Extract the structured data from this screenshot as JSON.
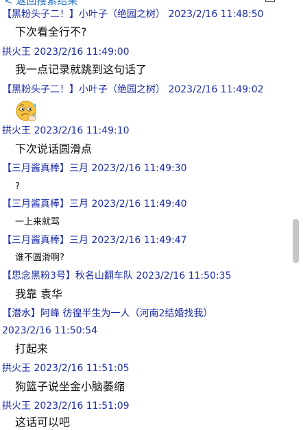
{
  "topbar": {
    "back_label": "< 返回搜索结果",
    "export_icon": "export-icon"
  },
  "messages": [
    {
      "sender": "【黑粉头子二！】小叶子（绝园之树）",
      "time": "2023/2/16 11:48:50",
      "text": "下次看全行不?"
    },
    {
      "sender": "拱火王",
      "time": "2023/2/16 11:49:00",
      "text": "我一点记录就跳到这句话了"
    },
    {
      "sender": "【黑粉头子二！】小叶子（绝园之树）",
      "time": "2023/2/16 11:49:02",
      "emoji": "sweating-smile-emoji"
    },
    {
      "sender": "拱火王",
      "time": "2023/2/16 11:49:10",
      "text": "下次说话圆滑点"
    },
    {
      "sender": "【三月酱真棒】三月",
      "time": "2023/2/16 11:49:30",
      "text": "?"
    },
    {
      "sender": "【三月酱真棒】三月",
      "time": "2023/2/16 11:49:40",
      "text": "一上来就骂"
    },
    {
      "sender": "【三月酱真棒】三月",
      "time": "2023/2/16 11:49:47",
      "text": "谁不圆滑啊?"
    },
    {
      "sender": "【思念黑粉3号】秋名山翻车队",
      "time": "2023/2/16 11:50:35",
      "text": "我靠 袁华"
    },
    {
      "sender": "【潜水】阿峰 彷徨半生为一人（河南2结婚找我）",
      "time": "2023/2/16 11:50:54",
      "text": "打起来"
    },
    {
      "sender": "拱火王",
      "time": "2023/2/16 11:51:05",
      "text": "狗篮子说坐金小脑萎缩"
    },
    {
      "sender": "拱火王",
      "time": "2023/2/16 11:51:09",
      "text": "这话可以吧"
    }
  ]
}
